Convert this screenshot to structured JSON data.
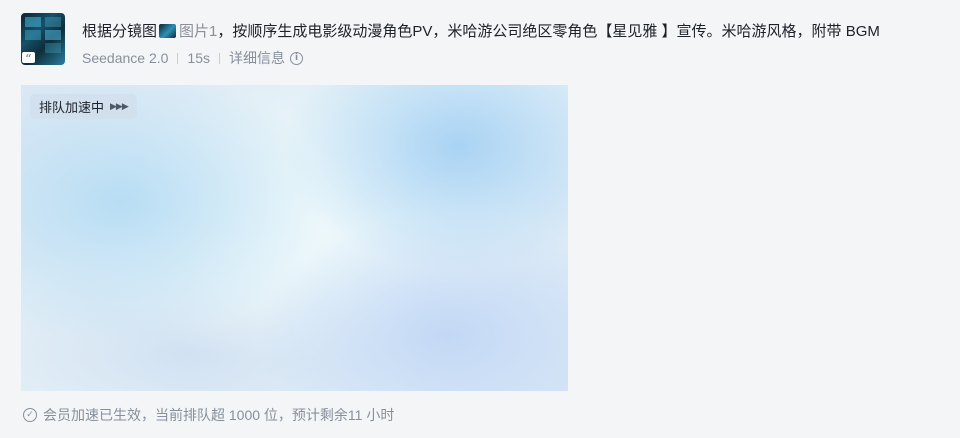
{
  "prompt": {
    "text_before": "根据分镜图",
    "ref_label": "图片1",
    "text_after": "，按顺序生成电影级动漫角色PV，米哈游公司绝区零角色【星见雅 】宣传。米哈游风格，附带 BGM"
  },
  "meta": {
    "model": "Seedance 2.0",
    "duration": "15s",
    "details_label": "详细信息"
  },
  "preview": {
    "badge_label": "排队加速中",
    "badge_arrows": "▶▶▶"
  },
  "status": {
    "text": "会员加速已生效，当前排队超 1000 位，预计剩余11 小时"
  },
  "icons": {
    "quote": "quote-icon",
    "info": "info-icon",
    "check": "check-circle-icon",
    "arrows": "play-arrows-icon"
  }
}
